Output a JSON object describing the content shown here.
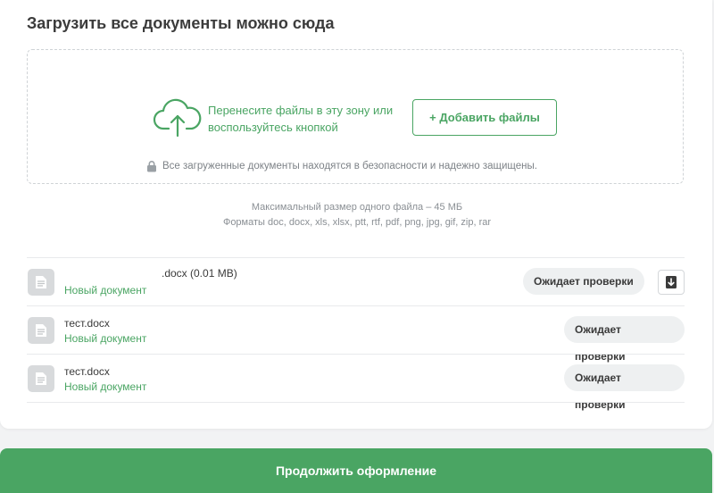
{
  "upload": {
    "title": "Загрузить все документы можно сюда",
    "dropzone_text": "Перенесите файлы в эту зону или воспользуйтесь кнопкой",
    "add_button": "+ Добавить файлы",
    "security_note": "Все загруженные документы находятся в безопасности и надежно защищены.",
    "max_size": "Максимальный размер одного файла – 45 МБ",
    "formats": "Форматы doc, docx, xls, xlsx, ptt, rtf, pdf, png, jpg, gif, zip, rar"
  },
  "files": [
    {
      "name": ".docx (0.01 MB)",
      "status": "Новый документ",
      "review": "Ожидает проверки"
    },
    {
      "name": "тест.docx",
      "status": "Новый документ",
      "review": "Ожидает проверки"
    },
    {
      "name": "тест.docx",
      "status": "Новый документ",
      "review": "Ожидает проверки"
    }
  ],
  "continue_button": "Продолжить оформление",
  "icons": {
    "upload": "cloud-upload-icon",
    "lock": "lock-icon",
    "file": "document-icon",
    "download": "download-icon"
  },
  "colors": {
    "accent": "#4aa563",
    "pill_bg": "#eef0f1",
    "file_icon_bg": "#d8dadc"
  }
}
